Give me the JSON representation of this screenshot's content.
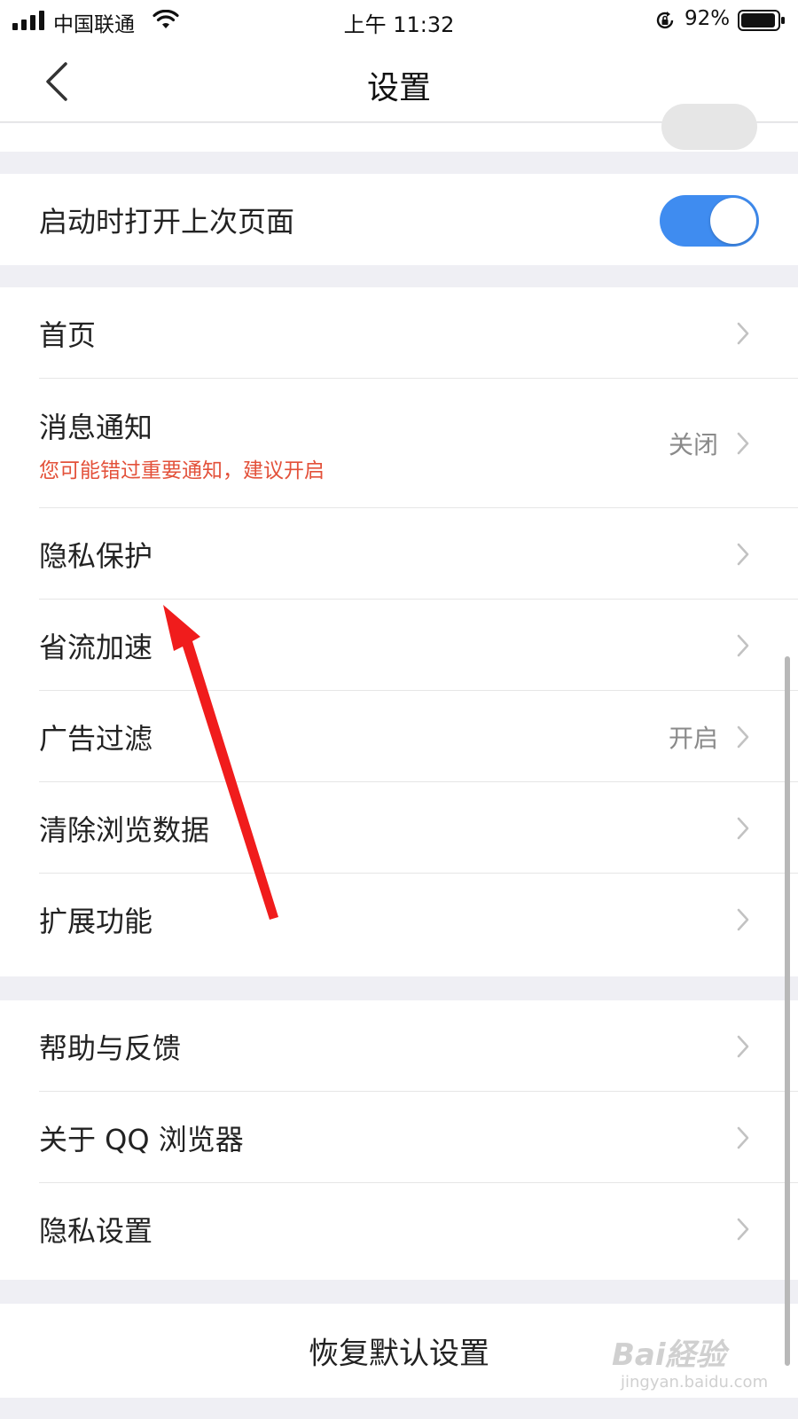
{
  "status_bar": {
    "carrier": "中国联通",
    "time": "上午 11:32",
    "battery": "92%",
    "icons": [
      "signal-icon",
      "wifi-icon",
      "rotation-lock-icon",
      "battery-icon"
    ]
  },
  "nav": {
    "title": "设置",
    "back_icon": "chevron-left-icon"
  },
  "settings": {
    "restore_last_page": {
      "label": "启动时打开上次页面",
      "toggle": true
    },
    "homepage": {
      "label": "首页"
    },
    "notifications": {
      "label": "消息通知",
      "hint": "您可能错过重要通知，建议开启",
      "value": "关闭"
    },
    "privacy_protection": {
      "label": "隐私保护"
    },
    "data_saver": {
      "label": "省流加速"
    },
    "ad_filter": {
      "label": "广告过滤",
      "value": "开启"
    },
    "clear_data": {
      "label": "清除浏览数据"
    },
    "extensions": {
      "label": "扩展功能"
    },
    "help_feedback": {
      "label": "帮助与反馈"
    },
    "about": {
      "label": "关于 QQ 浏览器"
    },
    "privacy_settings": {
      "label": "隐私设置"
    },
    "reset": {
      "label": "恢复默认设置"
    }
  },
  "watermark": {
    "main": "Bai経验",
    "sub": "jingyan.baidu.com"
  },
  "colors": {
    "accent": "#3f8cf0",
    "hint": "#e3513a",
    "arrow": "#f01c1c",
    "background": "#efeff4"
  }
}
